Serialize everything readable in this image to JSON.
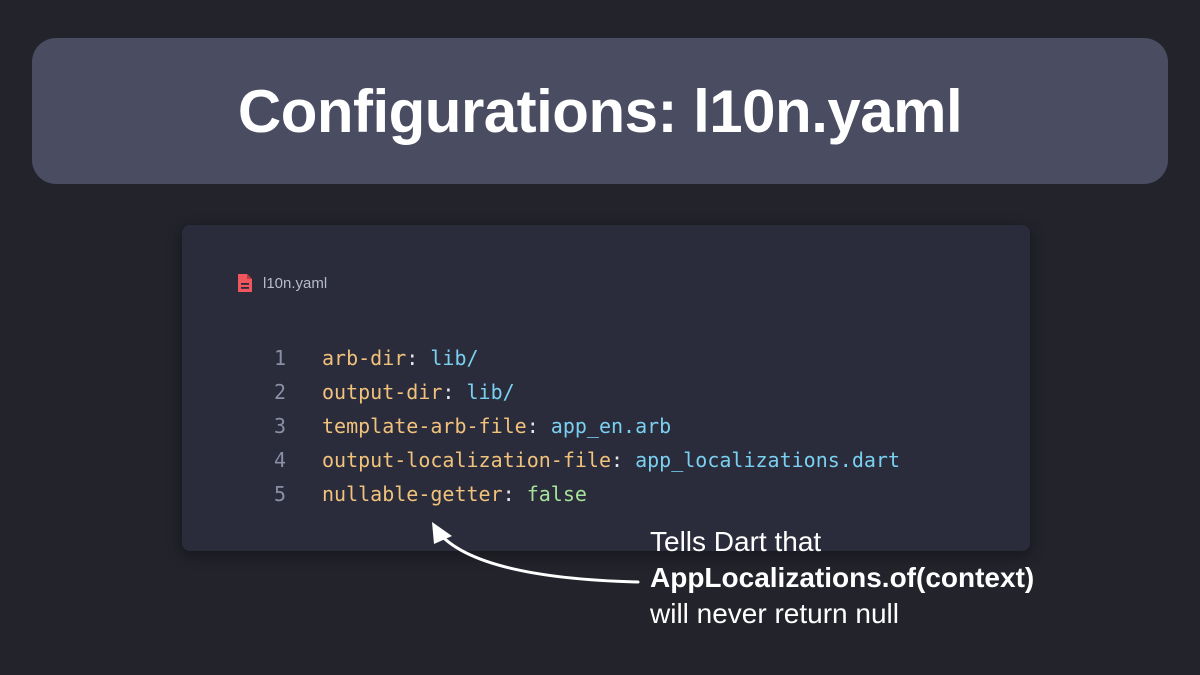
{
  "title": "Configurations: l10n.yaml",
  "file": {
    "name": "l10n.yaml",
    "icon": "yaml-file-icon",
    "icon_color": "#f0565d"
  },
  "code_lines": [
    {
      "number": "1",
      "key": "arb-dir",
      "value": "lib/",
      "value_type": "string"
    },
    {
      "number": "2",
      "key": "output-dir",
      "value": "lib/",
      "value_type": "string"
    },
    {
      "number": "3",
      "key": "template-arb-file",
      "value": "app_en.arb",
      "value_type": "string"
    },
    {
      "number": "4",
      "key": "output-localization-file",
      "value": "app_localizations.dart",
      "value_type": "string"
    },
    {
      "number": "5",
      "key": "nullable-getter",
      "value": "false",
      "value_type": "bool"
    }
  ],
  "annotation": {
    "line1": "Tells Dart that",
    "line2": "AppLocalizations.of(context)",
    "line3": "will never return null"
  },
  "colors": {
    "background": "#22232b",
    "banner": "#4a4c61",
    "card": "#2a2c3c",
    "key": "#f0c27b",
    "string": "#7ad0f0",
    "bool": "#a6e39a",
    "line_number": "#8b8fa5"
  }
}
